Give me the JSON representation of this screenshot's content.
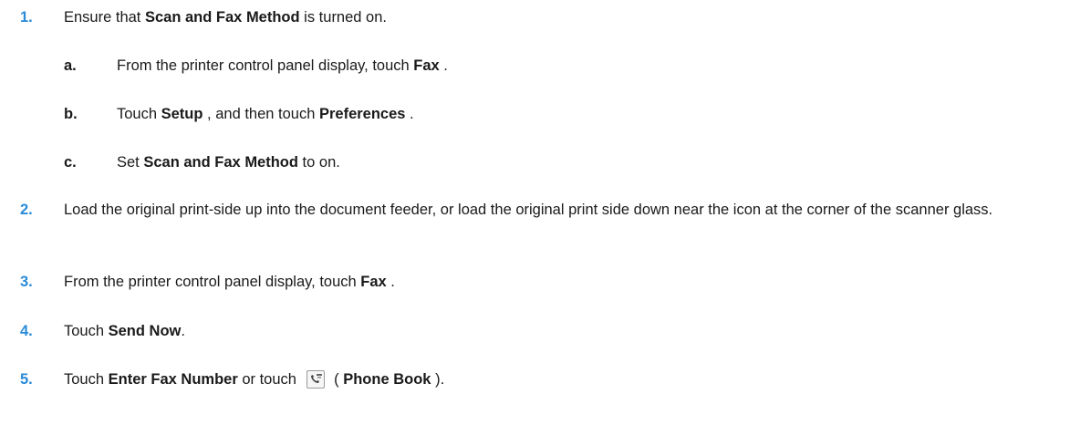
{
  "steps": [
    {
      "num": "1.",
      "pre": "Ensure that ",
      "b1": "Scan and Fax Method",
      "post": " is turned on."
    },
    {
      "num": "2.",
      "text": "Load the original print-side up into the document feeder, or load the original print side down near the icon at the corner of the scanner glass."
    },
    {
      "num": "3.",
      "pre": "From the printer control panel display, touch ",
      "b1": "Fax",
      "post": " ."
    },
    {
      "num": "4.",
      "pre": "Touch ",
      "b1": "Send Now",
      "post": "."
    },
    {
      "num": "5.",
      "pre": "Touch ",
      "b1": "Enter Fax Number",
      "mid": " or touch ",
      "paren_open": " ( ",
      "b2": "Phone Book",
      "post": " )."
    }
  ],
  "substeps": [
    {
      "letter": "a.",
      "pre": "From the printer control panel display, touch ",
      "b1": "Fax",
      "post": " ."
    },
    {
      "letter": "b.",
      "pre": "Touch ",
      "b1": "Setup",
      "mid": " , and then touch ",
      "b2": "Preferences",
      "post": " ."
    },
    {
      "letter": "c.",
      "pre": "Set ",
      "b1": "Scan and Fax Method",
      "post": " to on."
    }
  ],
  "colors": {
    "step_number": "#2a8bd8",
    "text": "#1a1a1a"
  },
  "icons": {
    "phone_book": "phone-book-icon"
  }
}
